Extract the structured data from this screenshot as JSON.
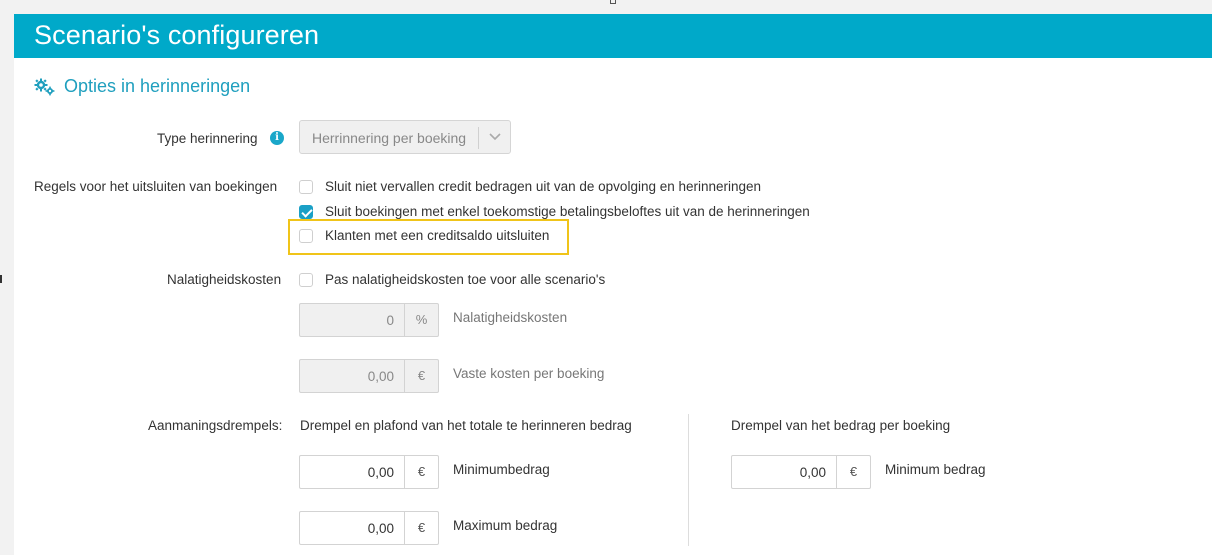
{
  "header": {
    "title": "Scenario's configureren"
  },
  "section": {
    "title": "Opties in herinneringen",
    "icon": "gears-icon"
  },
  "type_herinnering": {
    "label": "Type herinnering",
    "info_icon": "i",
    "select_value": "Herrinnering per boeking"
  },
  "regels": {
    "label": "Regels voor het uitsluiten van boekingen",
    "options": [
      {
        "label": "Sluit niet vervallen credit bedragen uit van de opvolging en herinneringen",
        "checked": false
      },
      {
        "label": "Sluit boekingen met enkel toekomstige betalingsbeloftes uit van de herinneringen",
        "checked": true
      },
      {
        "label": "Klanten met een creditsaldo uitsluiten",
        "checked": false
      }
    ]
  },
  "nalatigheid": {
    "label": "Nalatigheidskosten",
    "checkbox_label": "Pas nalatigheidskosten toe voor alle scenario's",
    "checked": false,
    "percent_value": "0",
    "percent_unit": "%",
    "percent_label": "Nalatigheidskosten",
    "fixed_value": "0,00",
    "fixed_unit": "€",
    "fixed_label": "Vaste kosten per boeking"
  },
  "aanmaning": {
    "label": "Aanmaningsdrempels:",
    "total_heading": "Drempel en plafond van het totale te herinneren bedrag",
    "min_value": "0,00",
    "min_unit": "€",
    "min_label": "Minimumbedrag",
    "max_value": "0,00",
    "max_unit": "€",
    "max_label": "Maximum bedrag",
    "per_booking_heading": "Drempel van het bedrag per boeking",
    "per_booking_value": "0,00",
    "per_booking_unit": "€",
    "per_booking_label": "Minimum bedrag"
  },
  "colors": {
    "header": "#00a9c9",
    "accent": "#1aa0c6",
    "highlight": "#f0c419"
  }
}
